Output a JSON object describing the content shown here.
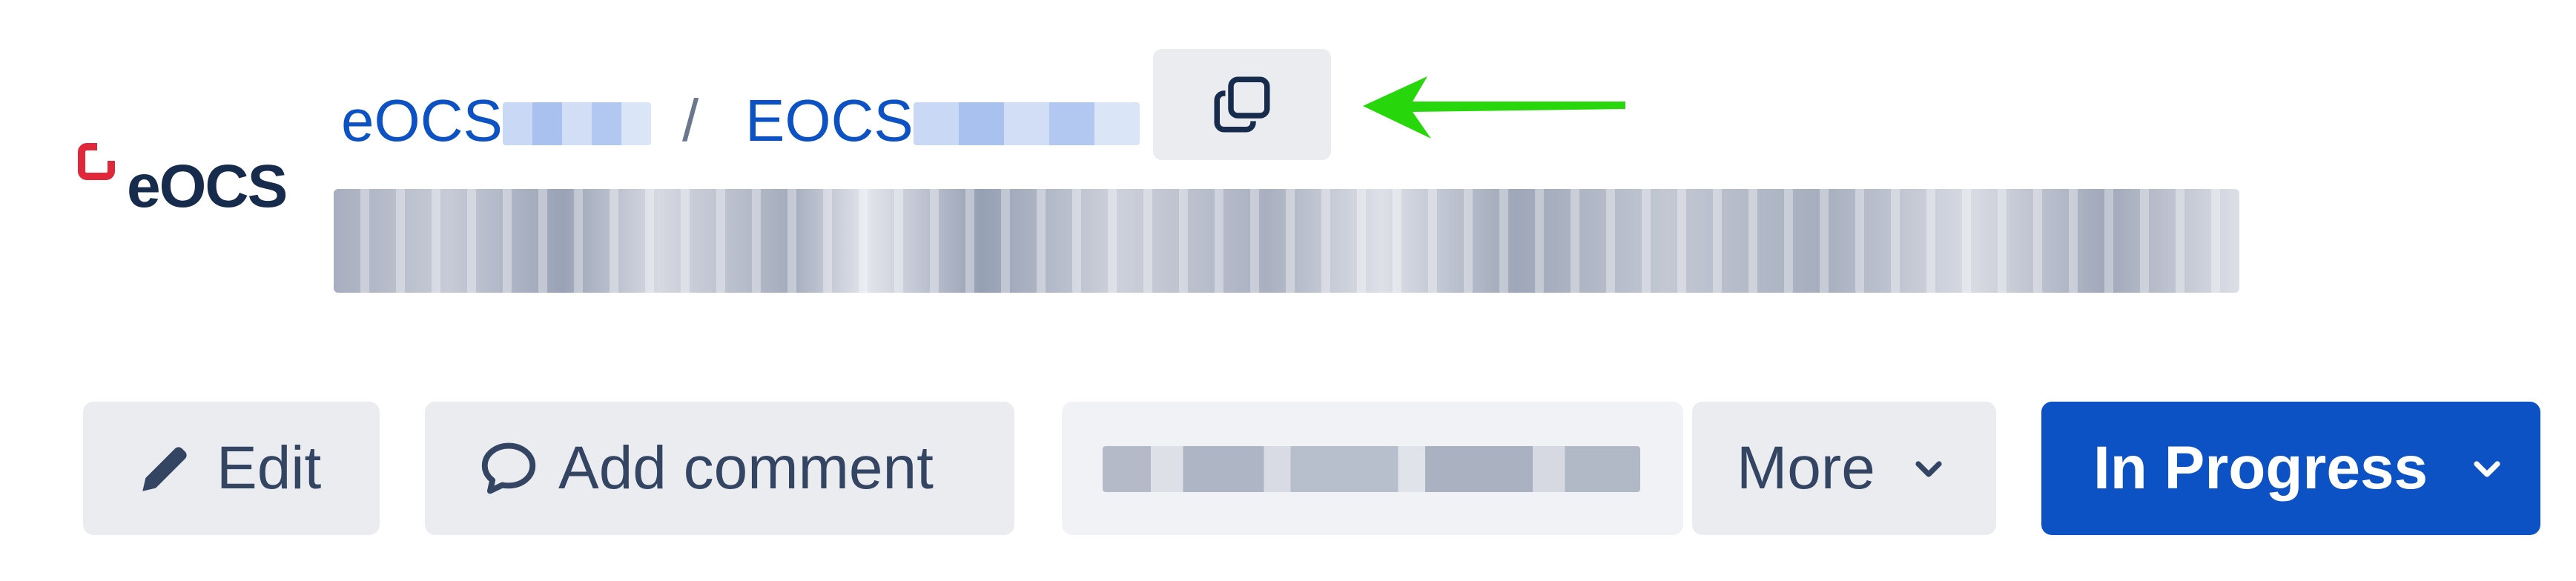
{
  "logo": {
    "text": "eOCS",
    "mark_color": "#e0283a"
  },
  "breadcrumb": {
    "project": "eOCS",
    "separator": "/",
    "issue_key": "EOCS",
    "copy_icon": "copy-link-icon",
    "arrow_annotation_color": "#27d60b"
  },
  "issue": {
    "title": ""
  },
  "actions": {
    "edit_label": "Edit",
    "edit_icon": "pencil-icon",
    "comment_label": "Add comment",
    "comment_icon": "speech-bubble-icon",
    "more_label": "More",
    "more_icon": "chevron-down-icon"
  },
  "status": {
    "label": "In Progress",
    "color": "#0c52c4",
    "icon": "chevron-down-icon"
  }
}
